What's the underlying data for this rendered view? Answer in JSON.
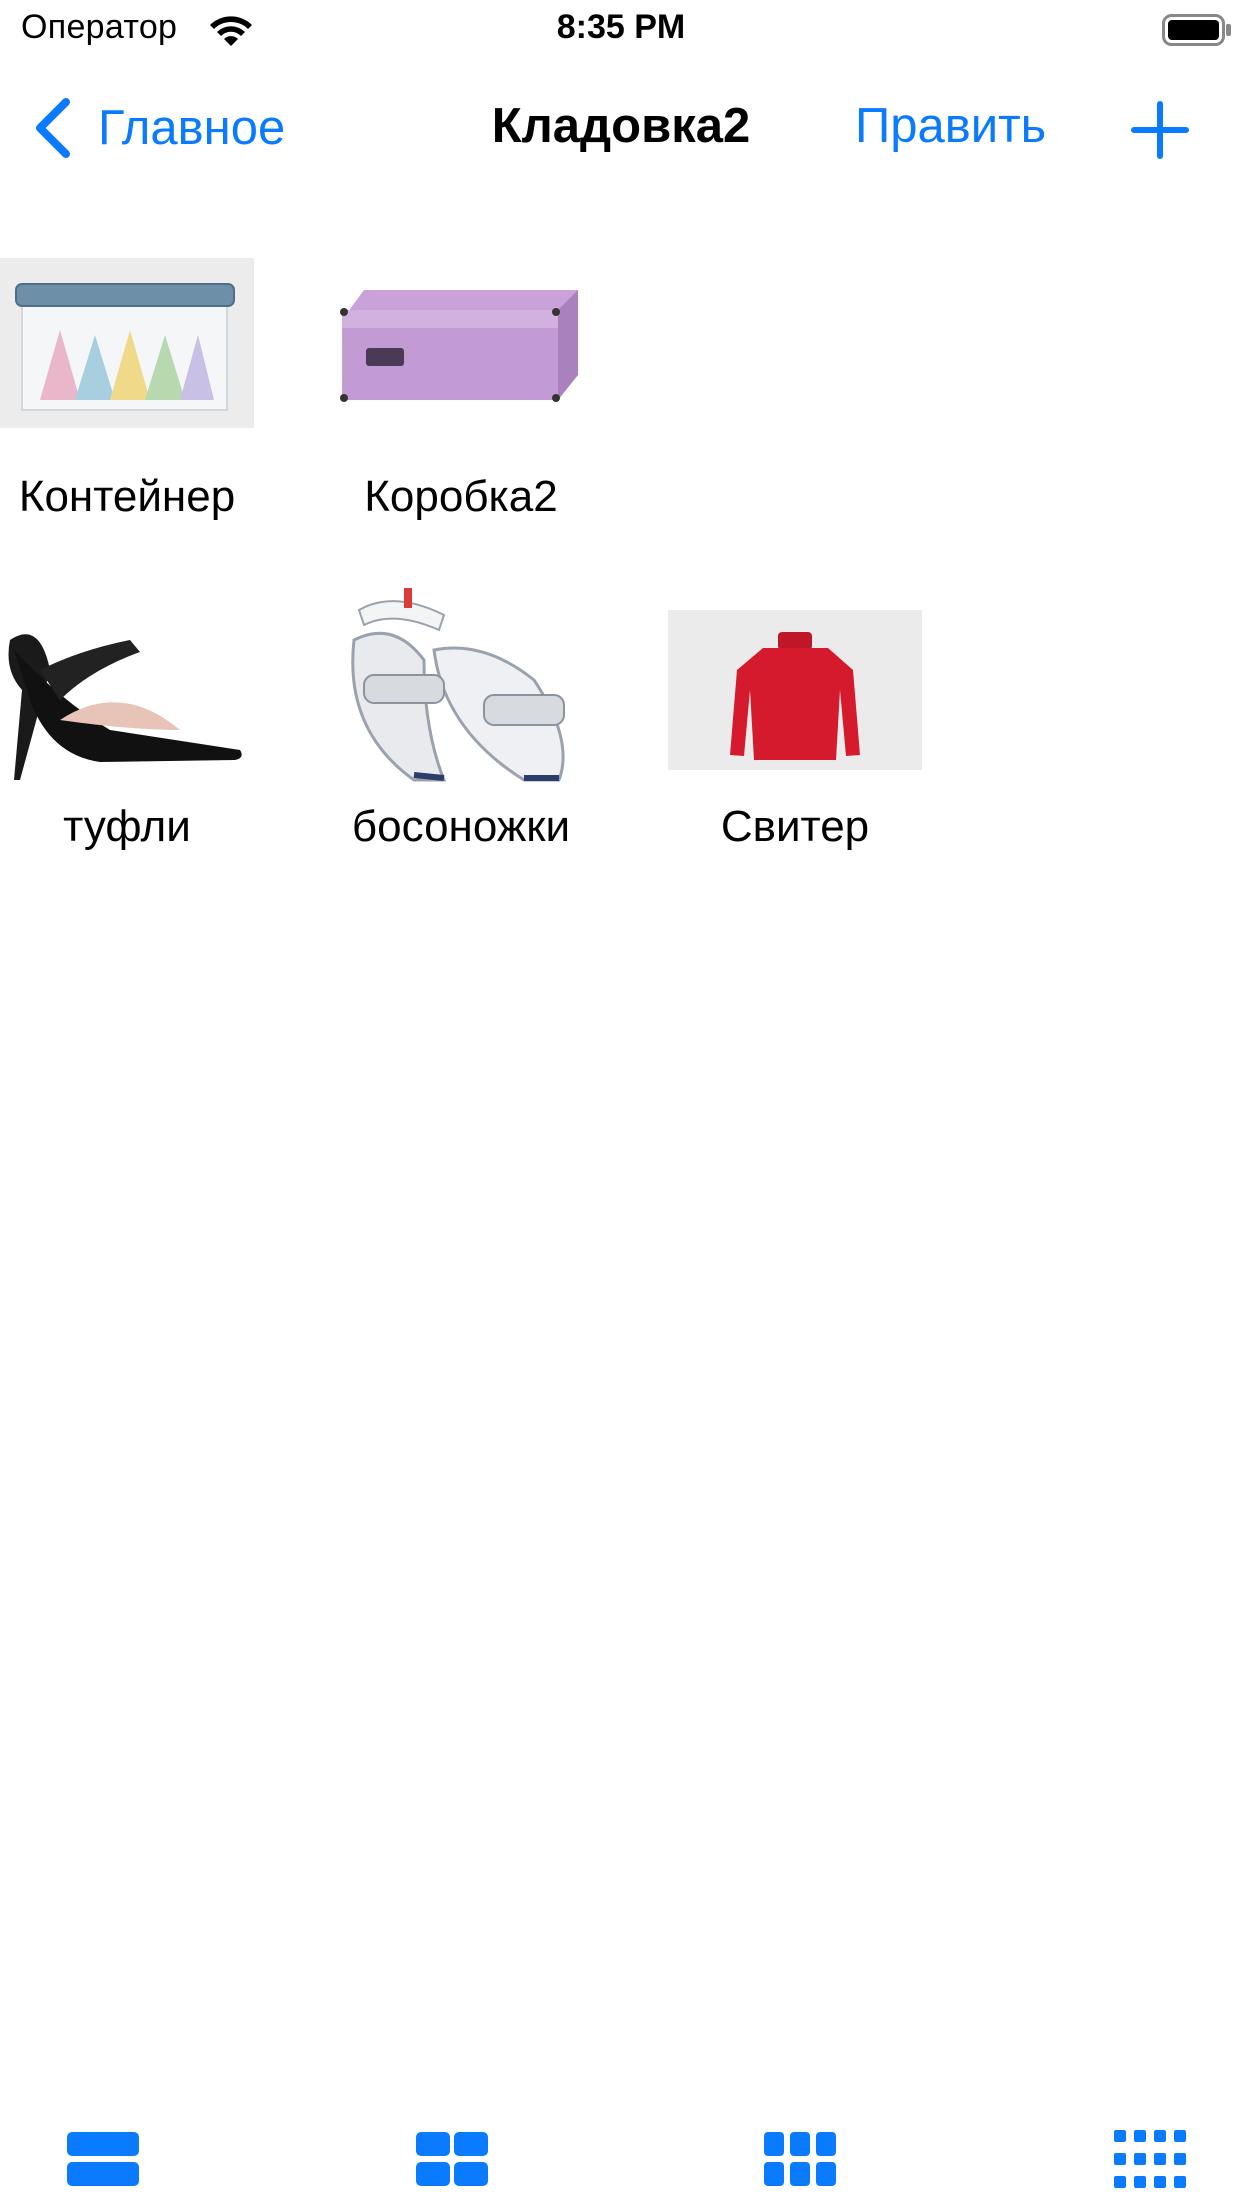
{
  "status_bar": {
    "carrier": "Оператор",
    "time": "8:35 PM",
    "icons": [
      "wifi-icon",
      "battery-icon"
    ]
  },
  "nav": {
    "back_label": "Главное",
    "back_icon": "chevron-left-icon",
    "title": "Кладовка2",
    "edit_label": "Править",
    "add_icon": "plus-icon"
  },
  "items": [
    {
      "label": "Контейнер",
      "image": "plastic-container-photo"
    },
    {
      "label": "Коробка2",
      "image": "lilac-box-photo"
    },
    {
      "label": "туфли",
      "image": "black-heel-shoe-photo"
    },
    {
      "label": "босоножки",
      "image": "white-sandals-photo"
    },
    {
      "label": "Свитер",
      "image": "red-sweater-photo"
    }
  ],
  "toolbar": {
    "layouts": [
      "layout-list-icon",
      "layout-grid-2-icon",
      "layout-grid-3-icon",
      "layout-grid-4-icon"
    ]
  },
  "colors": {
    "accent": "#0A7AFF",
    "text": "#000000",
    "background": "#FFFFFF"
  }
}
